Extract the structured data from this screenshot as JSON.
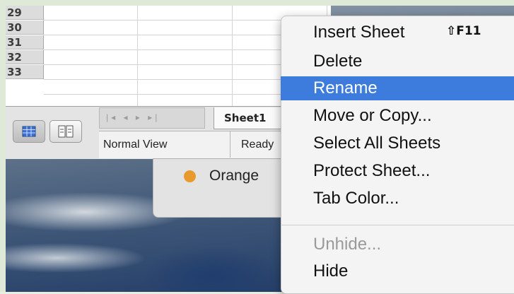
{
  "spreadsheet": {
    "row_numbers": [
      "29",
      "30",
      "31",
      "32",
      "33"
    ]
  },
  "tabs": {
    "sheet_tab": "Sheet1",
    "nav_arrows": "|◂ ◂ ▸ ▸|"
  },
  "status": {
    "view_label": "Normal View",
    "ready_label": "Ready"
  },
  "panel": {
    "item_label": "Orange",
    "dot_color": "#e99a2c"
  },
  "context_menu": {
    "items": [
      {
        "label": "Insert Sheet",
        "shortcut": "⇧F11"
      },
      {
        "label": "Delete"
      },
      {
        "label": "Rename",
        "highlighted": true
      },
      {
        "label": "Move or Copy..."
      },
      {
        "label": "Select All Sheets"
      },
      {
        "label": "Protect Sheet..."
      },
      {
        "label": "Tab Color..."
      },
      {
        "label": "Unhide...",
        "disabled": true
      },
      {
        "label": "Hide"
      }
    ],
    "highlight_color": "#3d7bdc"
  }
}
